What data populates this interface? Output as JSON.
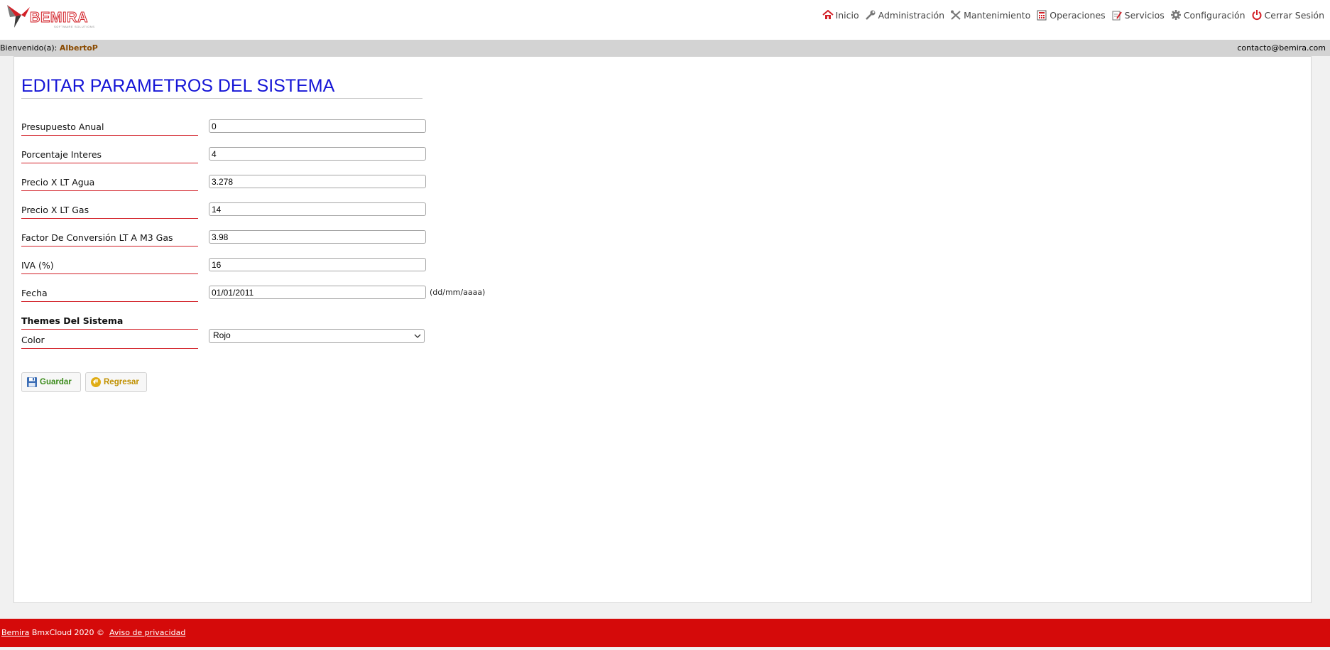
{
  "brand": {
    "logo_text": "BEMIRA",
    "logo_subtext": "SOFTWARE SOLUTIONS"
  },
  "nav": [
    {
      "label": "Inicio",
      "icon": "home-icon"
    },
    {
      "label": "Administración",
      "icon": "wrench-icon"
    },
    {
      "label": "Mantenimiento",
      "icon": "tools-icon"
    },
    {
      "label": "Operaciones",
      "icon": "calculator-icon"
    },
    {
      "label": "Servicios",
      "icon": "edit-document-icon"
    },
    {
      "label": "Configuración",
      "icon": "gear-icon"
    },
    {
      "label": "Cerrar Sesión",
      "icon": "power-icon"
    }
  ],
  "userbar": {
    "welcome_prefix": "Bienvenido(a):",
    "username": "AlbertoP",
    "contact": "contacto@bemira.com"
  },
  "page": {
    "title": "EDITAR PARAMETROS DEL SISTEMA"
  },
  "form": {
    "fields": [
      {
        "label": "Presupuesto Anual",
        "value": "0"
      },
      {
        "label": "Porcentaje Interes",
        "value": "4"
      },
      {
        "label": "Precio X LT Agua",
        "value": "3.278"
      },
      {
        "label": "Precio X LT Gas",
        "value": "14"
      },
      {
        "label": "Factor De Conversión LT A M3 Gas",
        "value": "3.98"
      },
      {
        "label": "IVA (%)",
        "value": "16"
      },
      {
        "label": "Fecha",
        "value": "01/01/2011",
        "hint": "(dd/mm/aaaa)"
      }
    ],
    "themes_heading": "Themes Del Sistema",
    "color": {
      "label": "Color",
      "selected": "Rojo"
    }
  },
  "buttons": {
    "save": "Guardar",
    "back": "Regresar"
  },
  "footer": {
    "brand_link": "Bemira",
    "text": "BmxCloud 2020 ©",
    "privacy_link": "Aviso de privacidad"
  },
  "colors": {
    "accent_red": "#d50a0a",
    "title_blue": "#1515d6",
    "username_brown": "#8a4a00"
  }
}
